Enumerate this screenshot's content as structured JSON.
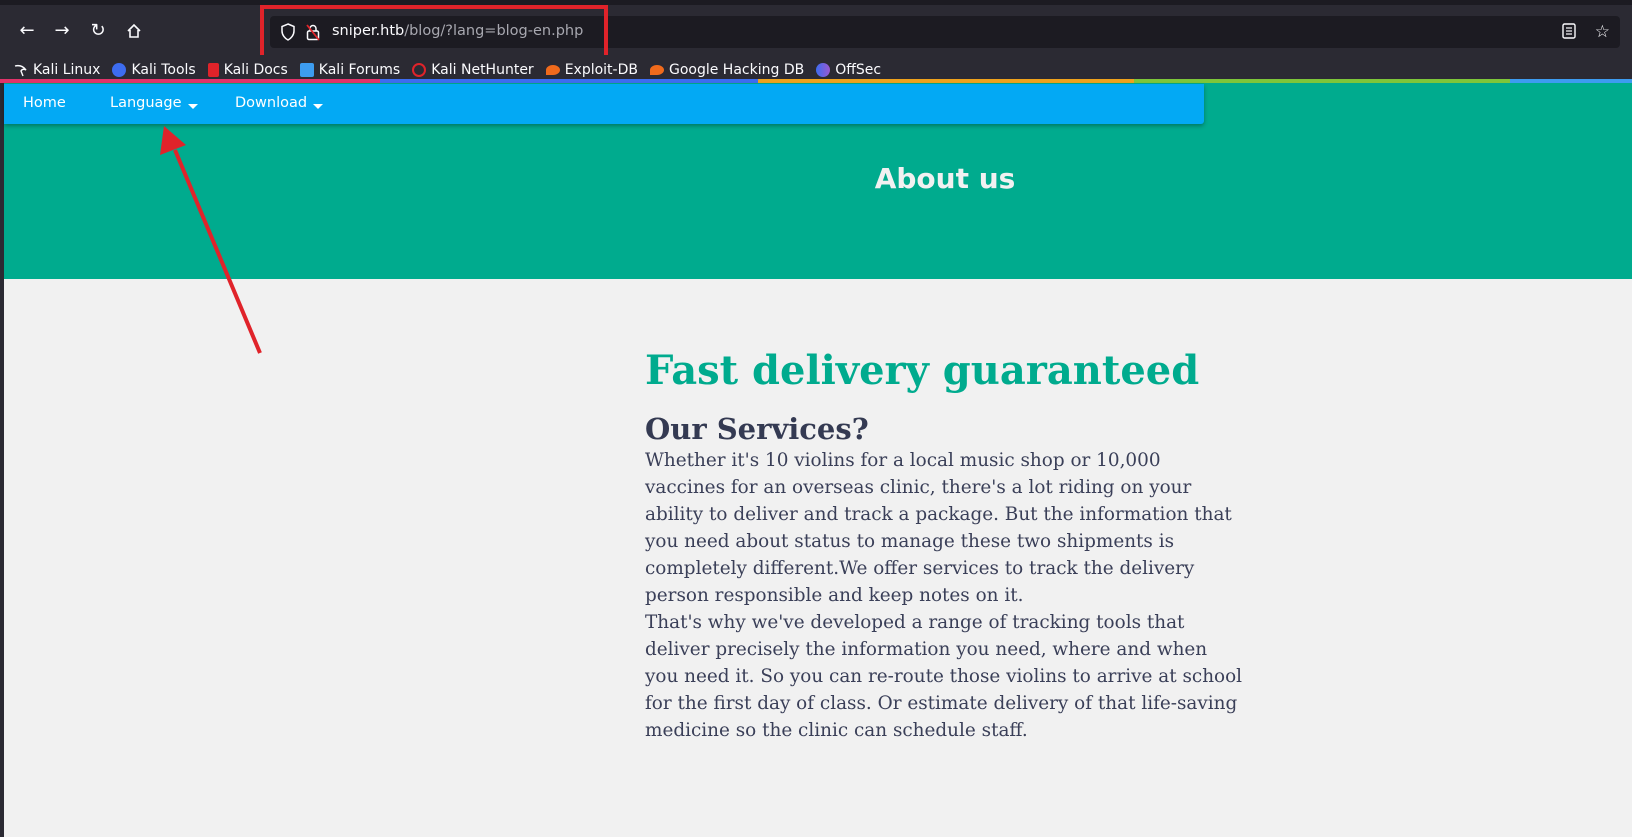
{
  "browser": {
    "url_host": "sniper.htb",
    "url_path": "/blog/?lang=blog-en.php",
    "bookmarks": [
      {
        "label": "Kali Linux",
        "icon": "kali-dragon-icon",
        "color": "#ffffff"
      },
      {
        "label": "Kali Tools",
        "icon": "kali-tools-icon",
        "color": "#3d6cf0"
      },
      {
        "label": "Kali Docs",
        "icon": "kali-docs-icon",
        "color": "#e0232a"
      },
      {
        "label": "Kali Forums",
        "icon": "kali-forums-icon",
        "color": "#3d9cf0"
      },
      {
        "label": "Kali NetHunter",
        "icon": "kali-nethunter-icon",
        "color": "#e0232a"
      },
      {
        "label": "Exploit-DB",
        "icon": "exploit-db-icon",
        "color": "#f06a1c"
      },
      {
        "label": "Google Hacking DB",
        "icon": "ghdb-icon",
        "color": "#f06a1c"
      },
      {
        "label": "OffSec",
        "icon": "offsec-icon",
        "color": "#3d6cf0"
      }
    ]
  },
  "site": {
    "nav": {
      "home": "Home",
      "language": "Language",
      "download": "Download"
    },
    "hero_title": "About us",
    "headline": "Fast delivery guaranteed",
    "subheading": "Our Services?",
    "paragraph1": "Whether it's 10 violins for a local music shop or 10,000 vaccines for an overseas clinic, there's a lot riding on your ability to deliver and track a package. But the information that you need about status to manage these two shipments is completely different.We offer services to track the delivery person responsible and keep notes on it.",
    "paragraph2": "That's why we've developed a range of tracking tools that deliver precisely the information you need, where and when you need it. So you can re-route those violins to arrive at school for the first day of class. Or estimate delivery of that life-saving medicine so the clinic can schedule staff."
  },
  "colors": {
    "accent_teal": "#00ab8e",
    "navbar_blue": "#03a9f4",
    "annotation_red": "#e0232a"
  }
}
